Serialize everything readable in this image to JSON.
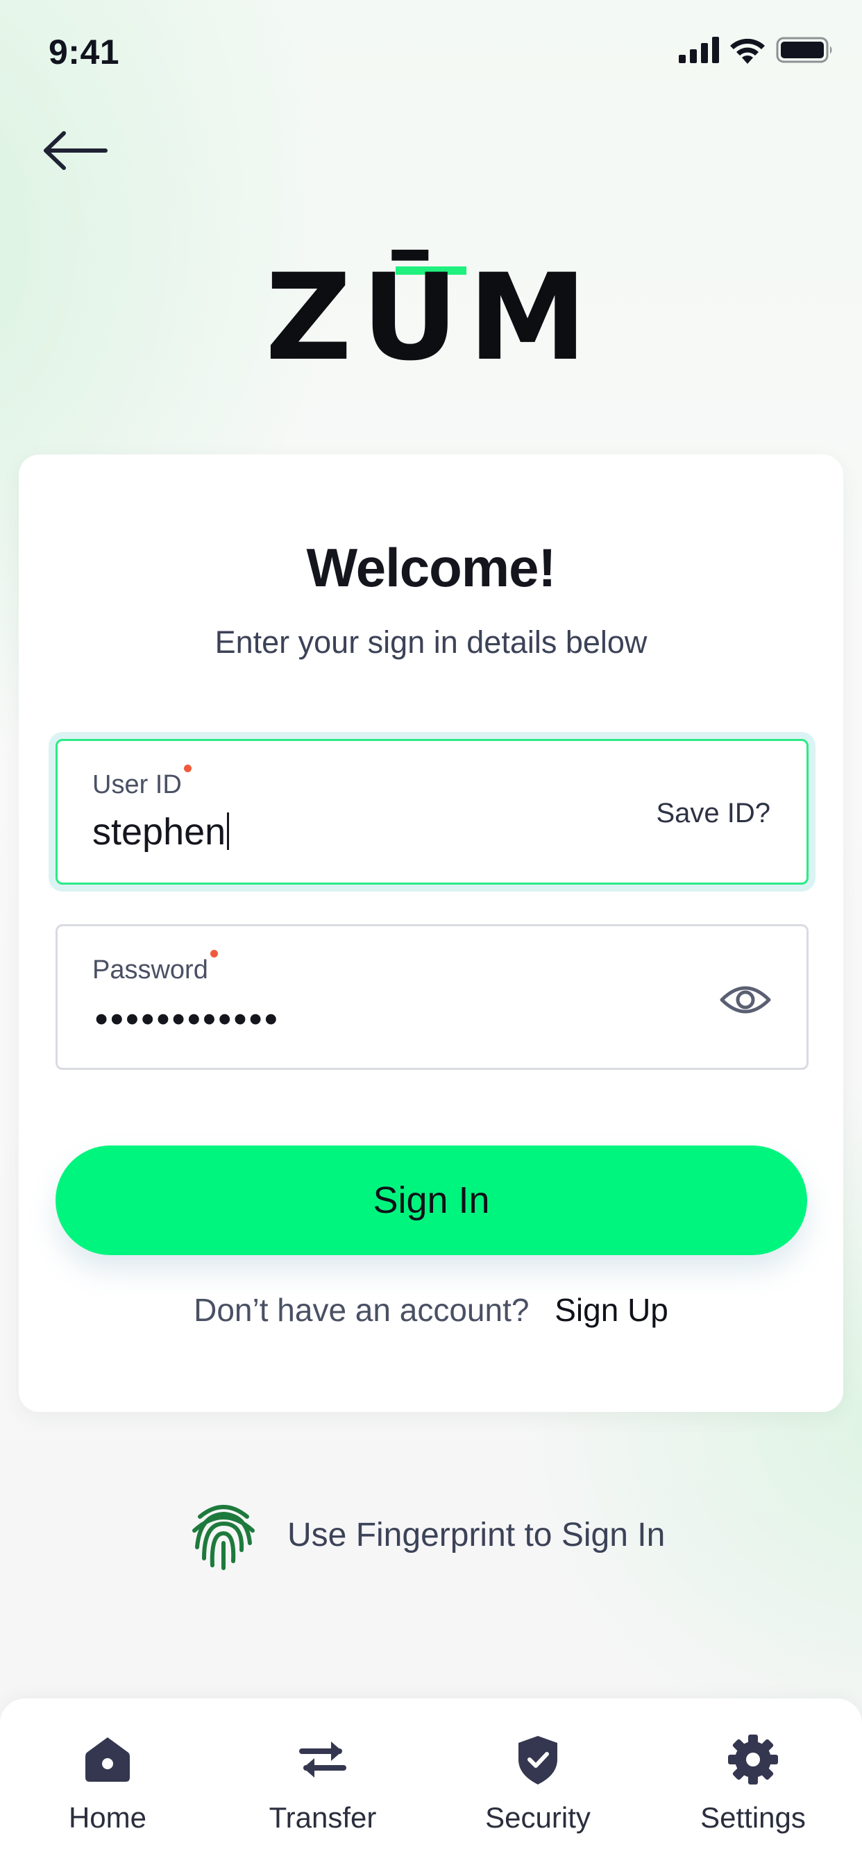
{
  "status_bar": {
    "time": "9:41"
  },
  "logo": {
    "text": "ZŪM"
  },
  "card": {
    "title": "Welcome!",
    "subtitle": "Enter your sign in details below",
    "user_id": {
      "label": "User ID",
      "value": "stephen",
      "save_label": "Save ID?"
    },
    "password": {
      "label": "Password",
      "masked_value": "••••••••••••"
    },
    "signin_label": "Sign In",
    "signup_question": "Don’t have an account?",
    "signup_link": "Sign Up"
  },
  "fingerprint": {
    "label": "Use Fingerprint to Sign In"
  },
  "nav": {
    "items": [
      {
        "label": "Home",
        "icon": "home-icon"
      },
      {
        "label": "Transfer",
        "icon": "transfer-icon"
      },
      {
        "label": "Security",
        "icon": "shield-icon"
      },
      {
        "label": "Settings",
        "icon": "gear-icon"
      }
    ]
  },
  "colors": {
    "accent": "#00f57e",
    "focus_border": "#2bea86",
    "required_dot": "#f05a3c",
    "fingerprint": "#1e7a3c",
    "nav_icon": "#34374f"
  }
}
